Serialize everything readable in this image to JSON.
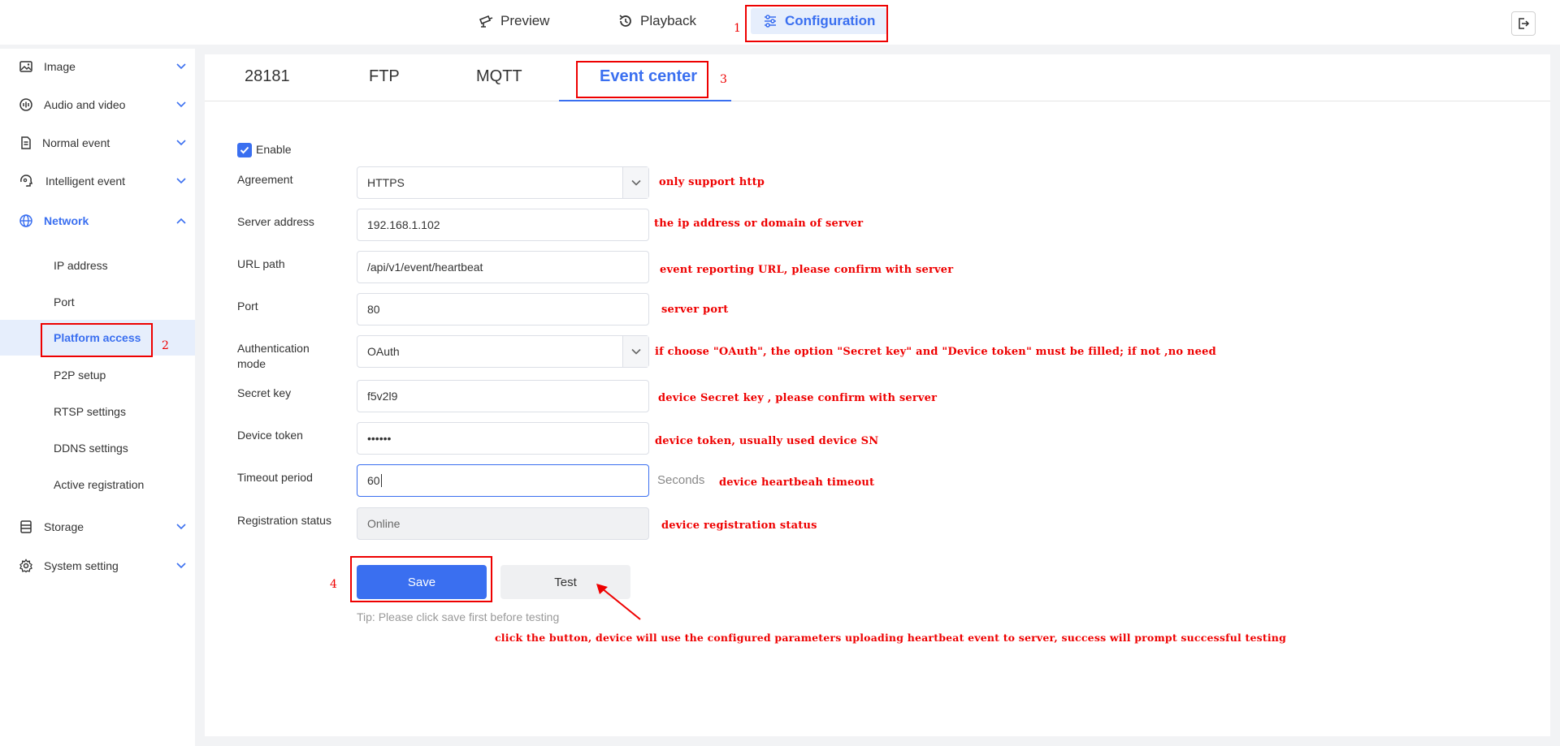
{
  "topnav": {
    "preview": "Preview",
    "playback": "Playback",
    "configuration": "Configuration"
  },
  "sidebar": {
    "groups": [
      {
        "label": "Image",
        "icon": "image-icon"
      },
      {
        "label": "Audio and video",
        "icon": "audio-video-icon"
      },
      {
        "label": "Normal event",
        "icon": "document-icon"
      },
      {
        "label": "Intelligent event",
        "icon": "brain-icon"
      },
      {
        "label": "Network",
        "icon": "globe-icon"
      },
      {
        "label": "Storage",
        "icon": "storage-icon"
      },
      {
        "label": "System setting",
        "icon": "gear-icon"
      }
    ],
    "network_items": [
      "IP address",
      "Port",
      "Platform access",
      "P2P setup",
      "RTSP settings",
      "DDNS settings",
      "Active registration"
    ]
  },
  "tabs": [
    "28181",
    "FTP",
    "MQTT",
    "Event center"
  ],
  "form": {
    "enable_label": "Enable",
    "enable_checked": true,
    "agreement_label": "Agreement",
    "agreement_value": "HTTPS",
    "server_label": "Server address",
    "server_value": "192.168.1.102",
    "url_label": "URL path",
    "url_value": "/api/v1/event/heartbeat",
    "port_label": "Port",
    "port_value": "80",
    "auth_label_1": "Authentication",
    "auth_label_2": "mode",
    "auth_value": "OAuth",
    "secret_label": "Secret key",
    "secret_value": "f5v2l9",
    "token_label": "Device token",
    "token_value": "••••••",
    "timeout_label": "Timeout period",
    "timeout_value": "60",
    "timeout_unit": "Seconds",
    "status_label": "Registration status",
    "status_value": "Online",
    "save": "Save",
    "test": "Test",
    "tip": "Tip: Please click save first before testing"
  },
  "annotations": {
    "n1": "1",
    "n2": "2",
    "n3": "3",
    "n4": "4",
    "agreement": "only support http",
    "server": "the ip address or domain of server",
    "url": "event reporting URL, please confirm  with  server",
    "port": "server port",
    "auth": "if choose \"OAuth\", the option \"Secret key\" and \"Device token\" must be filled; if not ,no need",
    "secret": "device Secret key , please confirm with  server",
    "token": "device token, usually used device SN",
    "timeout": "device heartbeah timeout",
    "status": "device registration status",
    "test": "click the button, device will use the configured parameters uploading heartbeat  event to server,  success will prompt successful  testing"
  },
  "colors": {
    "accent": "#3a6ff0",
    "annotation": "#e00000"
  }
}
